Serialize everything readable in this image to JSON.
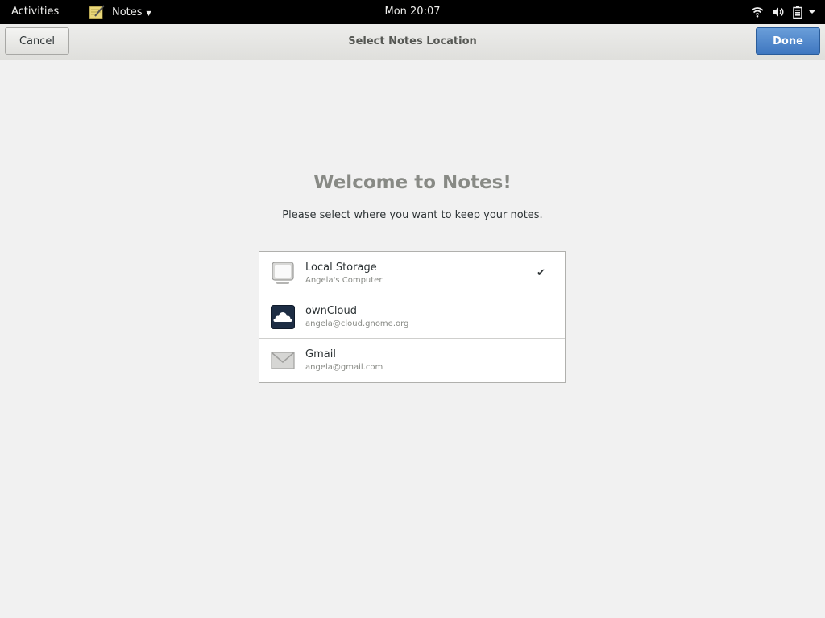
{
  "topbar": {
    "activities": "Activities",
    "app_name": "Notes",
    "clock": "Mon 20:07",
    "icons": [
      "wifi-icon",
      "volume-icon",
      "battery-icon",
      "chevron-down-icon"
    ]
  },
  "header": {
    "cancel_label": "Cancel",
    "title": "Select Notes Location",
    "done_label": "Done",
    "accent_color": "#4a85cb"
  },
  "main": {
    "welcome": "Welcome to Notes!",
    "subtitle": "Please select where you want to keep your notes.",
    "locations": [
      {
        "name": "Local Storage",
        "detail": "Angela's Computer",
        "icon": "computer-icon",
        "selected": true
      },
      {
        "name": "ownCloud",
        "detail": "angela@cloud.gnome.org",
        "icon": "owncloud-icon",
        "selected": false
      },
      {
        "name": "Gmail",
        "detail": "angela@gmail.com",
        "icon": "mail-icon",
        "selected": false
      }
    ],
    "check_glyph": "✔"
  }
}
